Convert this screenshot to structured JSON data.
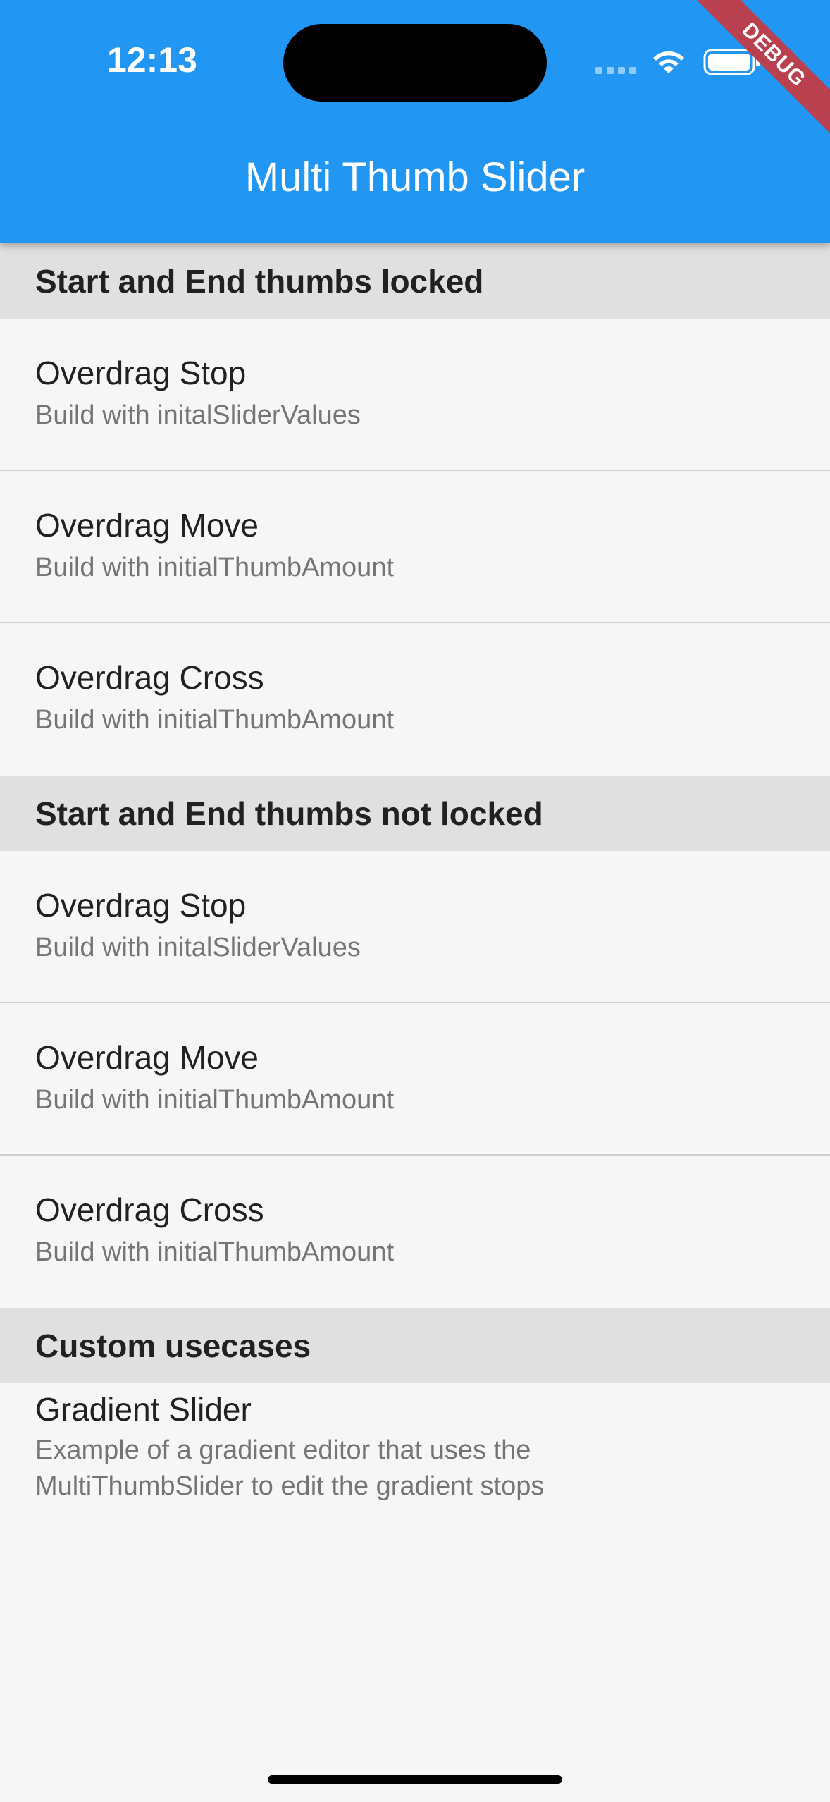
{
  "status_bar": {
    "time": "12:13"
  },
  "app_bar": {
    "title": "Multi Thumb Slider",
    "debug_label": "DEBUG",
    "color": "#2196f3"
  },
  "sections": [
    {
      "header": "Start and End thumbs locked",
      "items": [
        {
          "title": "Overdrag Stop",
          "subtitle": "Build with initalSliderValues"
        },
        {
          "title": "Overdrag Move",
          "subtitle": "Build with initialThumbAmount"
        },
        {
          "title": "Overdrag Cross",
          "subtitle": "Build with initialThumbAmount"
        }
      ]
    },
    {
      "header": "Start and End thumbs not locked",
      "items": [
        {
          "title": "Overdrag Stop",
          "subtitle": "Build with initalSliderValues"
        },
        {
          "title": "Overdrag Move",
          "subtitle": "Build with initialThumbAmount"
        },
        {
          "title": "Overdrag Cross",
          "subtitle": "Build with initialThumbAmount"
        }
      ]
    },
    {
      "header": "Custom usecases",
      "items": [
        {
          "title": "Gradient Slider",
          "subtitle_line1": "Example of a gradient editor that uses the",
          "subtitle_line2": "MultiThumbSlider to edit the gradient stops"
        }
      ]
    }
  ]
}
